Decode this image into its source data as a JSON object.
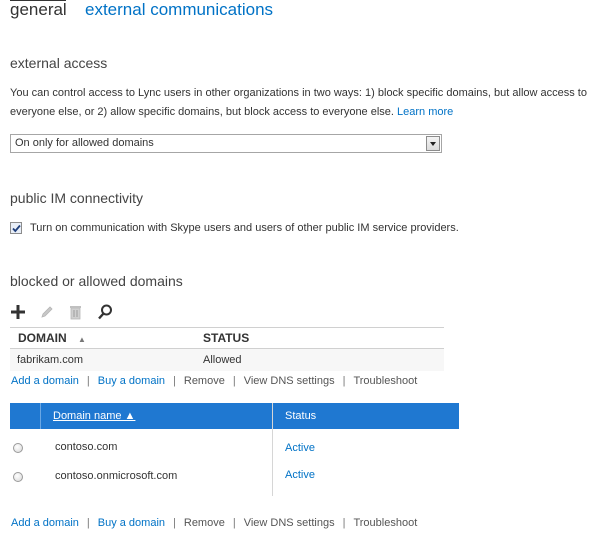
{
  "tabs": [
    {
      "label": "general"
    },
    {
      "label": "external communications"
    }
  ],
  "external_access": {
    "title": "external access",
    "description": "You can control access to Lync users in other organizations in two ways: 1) block specific domains, but allow access to everyone else, or 2) allow specific domains, but block access to everyone else.",
    "learn_more": "Learn more",
    "dropdown_value": "On only for allowed domains"
  },
  "public_im": {
    "title": "public IM connectivity",
    "checkbox_label": "Turn on communication with Skype users and users of other public IM service providers.",
    "checked": true
  },
  "domains": {
    "title": "blocked or allowed domains",
    "toolbar_icons": [
      "add-icon",
      "edit-icon",
      "delete-icon",
      "search-icon"
    ],
    "columns": [
      "DOMAIN",
      "STATUS"
    ],
    "sort_indicator": "▲",
    "rows": [
      {
        "domain": "fabrikam.com",
        "status": "Allowed"
      }
    ]
  },
  "actions_top": [
    "Add a domain",
    "Buy a domain",
    "Remove",
    "View DNS settings",
    "Troubleshoot"
  ],
  "domain_table": {
    "columns": [
      "Domain name ▲",
      "Status"
    ],
    "rows": [
      {
        "domain": "contoso.com",
        "status": "Active"
      },
      {
        "domain": "contoso.onmicrosoft.com",
        "status": "Active"
      }
    ],
    "header_color": "#1f78d1"
  },
  "actions_bottom": [
    "Add a domain",
    "Buy a domain",
    "Remove",
    "View DNS settings",
    "Troubleshoot"
  ],
  "colors": {
    "link": "#0072c6",
    "text": "#333333"
  }
}
